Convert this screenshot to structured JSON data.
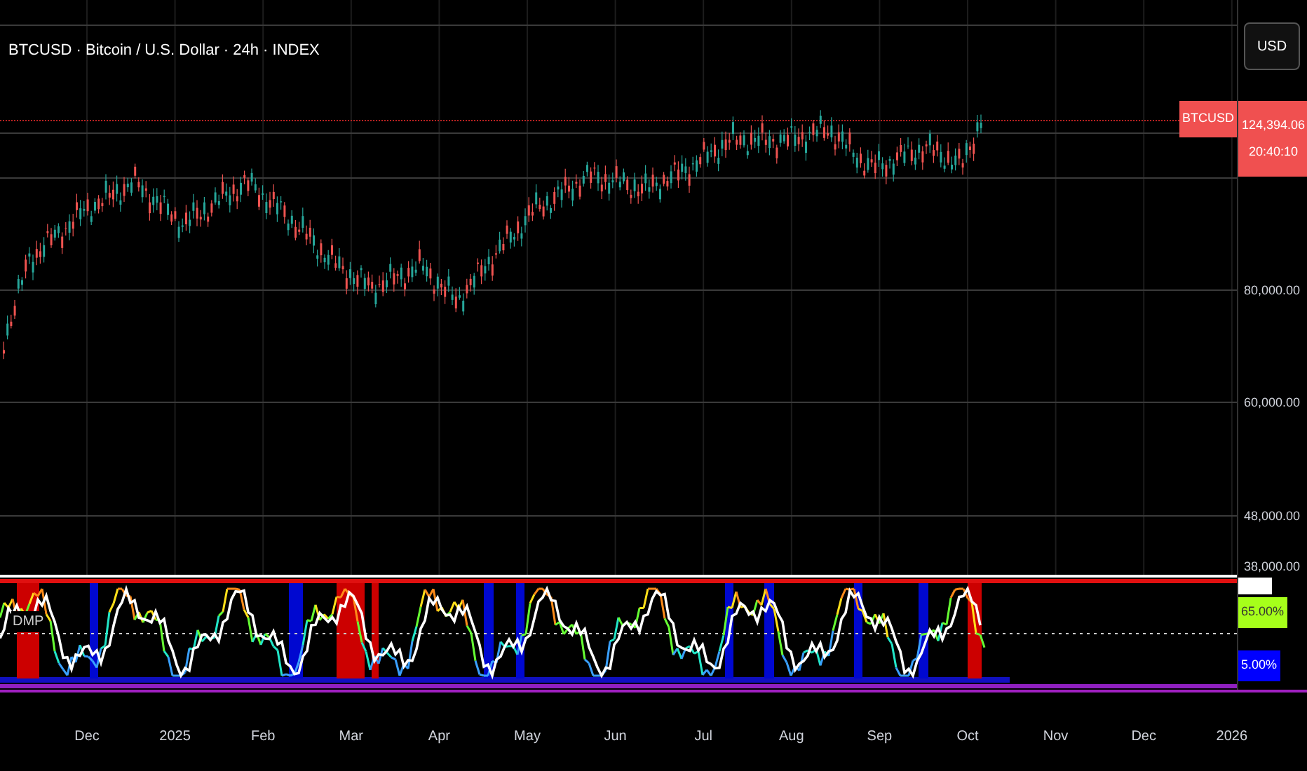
{
  "legend": {
    "title": "BTCUSD · Bitcoin / U.S. Dollar · 24h · INDEX"
  },
  "currency_button": {
    "label": "USD"
  },
  "price_tag": {
    "symbol": "BTCUSD",
    "price": "124,394.06",
    "countdown": "20:40:10"
  },
  "price_axis": {
    "labels": [
      "80,000.00",
      "60,000.00",
      "48,000.00",
      "38,000.00"
    ]
  },
  "indicator": {
    "name": "DMP",
    "tags": [
      {
        "text": "65.00%",
        "color": "#a6ff1a"
      },
      {
        "text": "5.00%",
        "color": "#0000ff"
      }
    ]
  },
  "time_axis": {
    "labels": [
      "Dec",
      "2025",
      "Feb",
      "Mar",
      "Apr",
      "May",
      "Jun",
      "Jul",
      "Aug",
      "Sep",
      "Oct",
      "Nov",
      "Dec",
      "2026"
    ]
  }
}
